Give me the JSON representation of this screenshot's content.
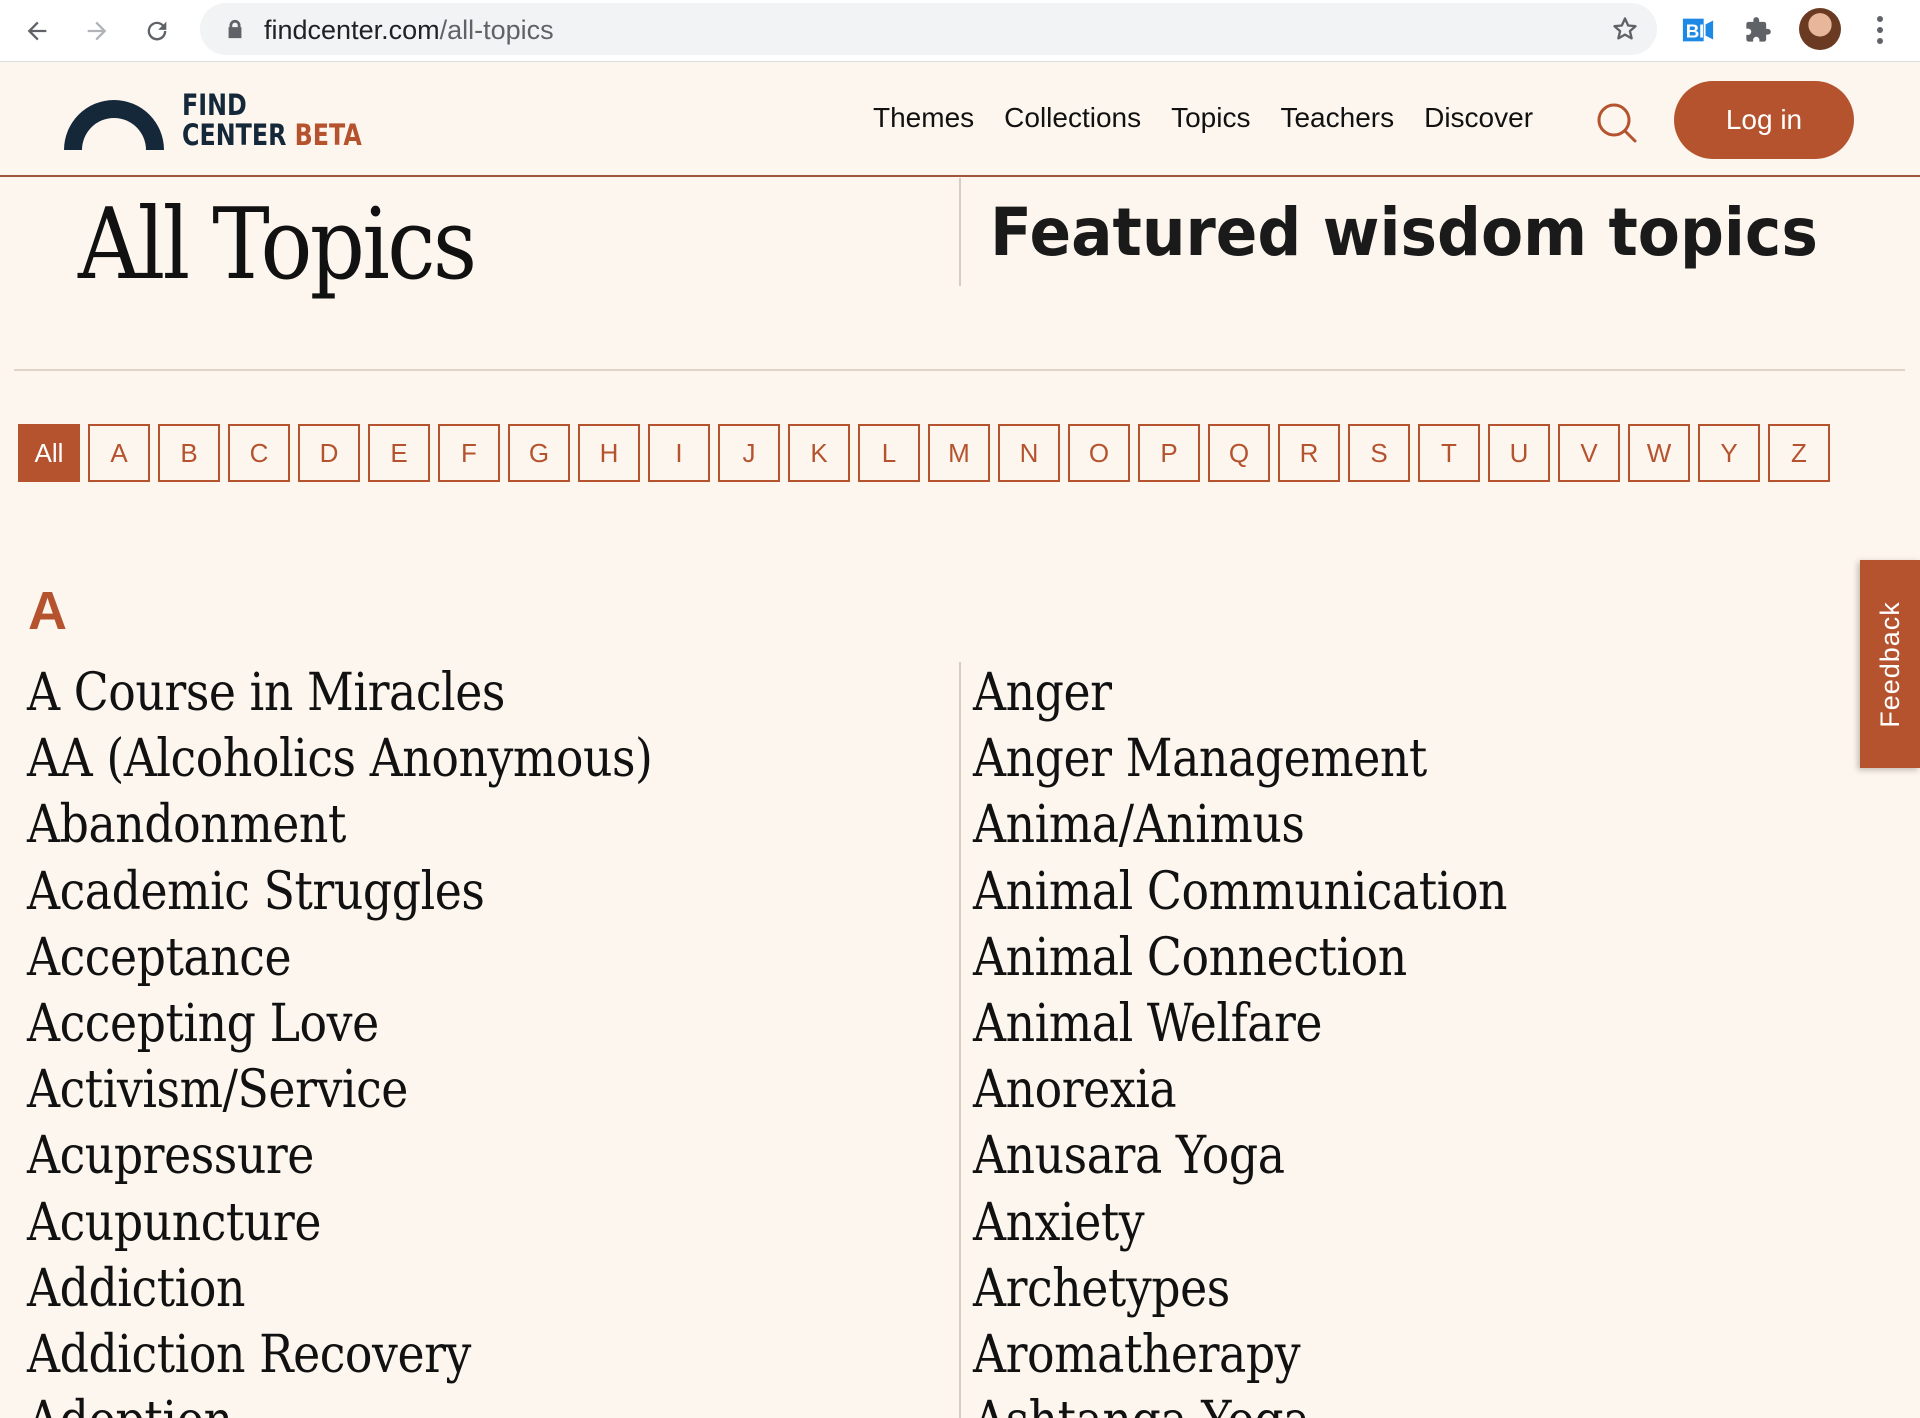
{
  "browser": {
    "url_domain": "findcenter.com",
    "url_path": "/all-topics",
    "icons": [
      "back-arrow-icon",
      "forward-arrow-icon",
      "reload-icon",
      "lock-icon",
      "star-icon",
      "extension-bi-icon",
      "puzzle-icon",
      "profile-avatar",
      "more-menu-icon"
    ]
  },
  "header": {
    "logo_line1": "FIND",
    "logo_line2": "CENTER",
    "logo_beta": "BETA",
    "nav": [
      "Themes",
      "Collections",
      "Topics",
      "Teachers",
      "Discover"
    ],
    "login_label": "Log in"
  },
  "page": {
    "title": "All Topics",
    "featured_title": "Featured wisdom topics"
  },
  "alphabet": {
    "active": "All",
    "letters": [
      "All",
      "A",
      "B",
      "C",
      "D",
      "E",
      "F",
      "G",
      "H",
      "I",
      "J",
      "K",
      "L",
      "M",
      "N",
      "O",
      "P",
      "Q",
      "R",
      "S",
      "T",
      "U",
      "V",
      "W",
      "Y",
      "Z"
    ]
  },
  "section": {
    "letter": "A",
    "left_topics": [
      "A Course in Miracles",
      "AA (Alcoholics Anonymous)",
      "Abandonment",
      "Academic Struggles",
      "Acceptance",
      "Accepting Love",
      "Activism/Service",
      "Acupressure",
      "Acupuncture",
      "Addiction",
      "Addiction Recovery",
      "Adoption"
    ],
    "right_topics": [
      "Anger",
      "Anger Management",
      "Anima/Animus",
      "Animal Communication",
      "Animal Connection",
      "Animal Welfare",
      "Anorexia",
      "Anusara Yoga",
      "Anxiety",
      "Archetypes",
      "Aromatherapy",
      "Ashtanga Yoga"
    ]
  },
  "feedback_label": "Feedback",
  "colors": {
    "accent": "#b5532f",
    "background": "#fdf6ee",
    "logo_navy": "#14283a"
  }
}
